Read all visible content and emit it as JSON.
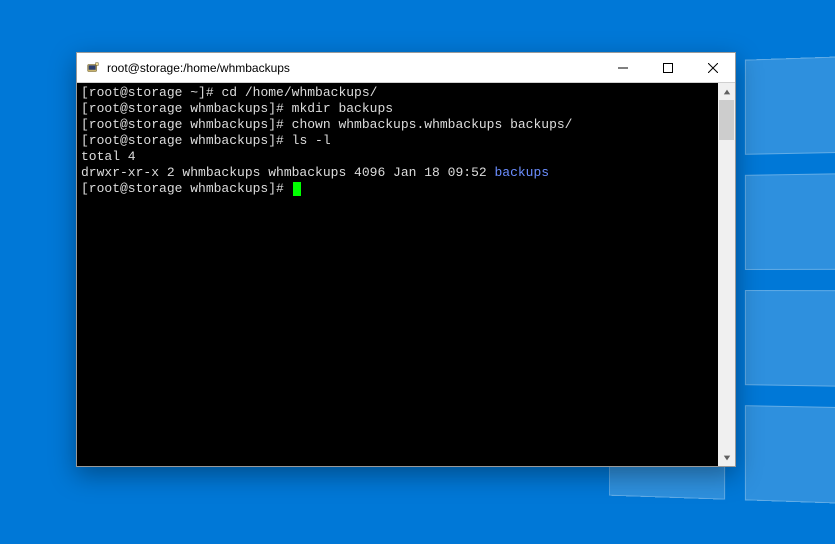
{
  "window": {
    "title": "root@storage:/home/whmbackups"
  },
  "terminal": {
    "prompt_home": "[root@storage ~]# ",
    "prompt_dir": "[root@storage whmbackups]# ",
    "cmd1": "cd /home/whmbackups/",
    "cmd2": "mkdir backups",
    "cmd3": "chown whmbackups.whmbackups backups/",
    "cmd4": "ls -l",
    "total_line": "total 4",
    "ls_row_prefix": "drwxr-xr-x 2 whmbackups whmbackups 4096 Jan 18 09:52 ",
    "ls_row_dirname": "backups"
  }
}
